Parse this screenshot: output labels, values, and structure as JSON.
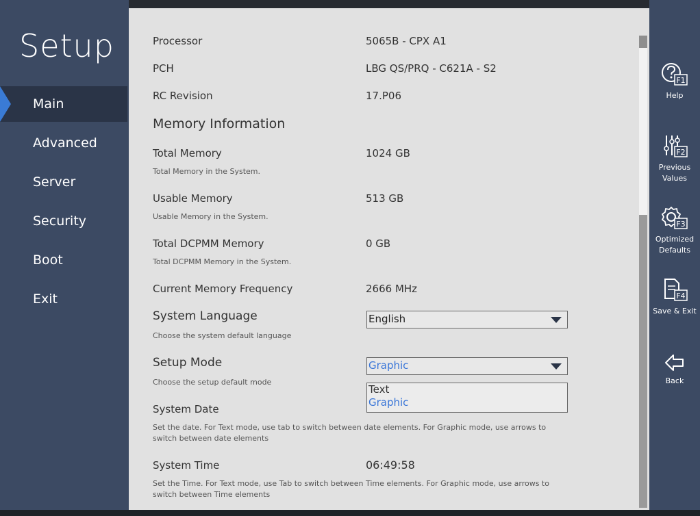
{
  "sidebar": {
    "title": "Setup",
    "items": [
      {
        "label": "Main",
        "active": true
      },
      {
        "label": "Advanced"
      },
      {
        "label": "Server"
      },
      {
        "label": "Security"
      },
      {
        "label": "Boot"
      },
      {
        "label": "Exit"
      }
    ]
  },
  "main": {
    "processor": {
      "label": "Processor",
      "value": "5065B - CPX A1"
    },
    "pch": {
      "label": "PCH",
      "value": "LBG QS/PRQ - C621A - S2"
    },
    "rc_revision": {
      "label": "RC Revision",
      "value": "17.P06"
    },
    "memory_section": "Memory Information",
    "total_memory": {
      "label": "Total Memory",
      "value": "1024 GB",
      "desc": "Total Memory in the System."
    },
    "usable_memory": {
      "label": "Usable Memory",
      "value": "513 GB",
      "desc": "Usable Memory in the System."
    },
    "total_dcpmm": {
      "label": "Total DCPMM Memory",
      "value": "0 GB",
      "desc": "Total DCPMM Memory in the System."
    },
    "memory_frequency": {
      "label": "Current Memory Frequency",
      "value": "2666 MHz"
    },
    "system_language": {
      "label": "System Language",
      "value": "English",
      "desc": "Choose the system default language"
    },
    "setup_mode": {
      "label": "Setup Mode",
      "value": "Graphic",
      "desc": "Choose the setup default mode",
      "options": [
        "Text",
        "Graphic"
      ]
    },
    "system_date": {
      "label": "System Date",
      "desc": "Set the date. For Text mode, use tab to switch between date elements. For Graphic mode, use arrows to switch between date elements"
    },
    "system_time": {
      "label": "System Time",
      "value": "06:49:58",
      "desc": "Set the Time. For Text mode, use Tab to switch between Time elements. For Graphic mode, use arrows to switch between Time elements"
    }
  },
  "actions": {
    "help": {
      "label": "Help",
      "key": "F1"
    },
    "previous": {
      "label": "Previous Values",
      "key": "F2"
    },
    "optimized": {
      "label": "Optimized Defaults",
      "key": "F3"
    },
    "save_exit": {
      "label": "Save & Exit",
      "key": "F4"
    },
    "back": {
      "label": "Back"
    }
  },
  "colors": {
    "sidebar_bg": "#3c4a63",
    "active_bg": "#2a3447",
    "accent": "#3a7bd5",
    "content_bg": "#e1e1e1",
    "selected_text": "#3a76d8"
  }
}
